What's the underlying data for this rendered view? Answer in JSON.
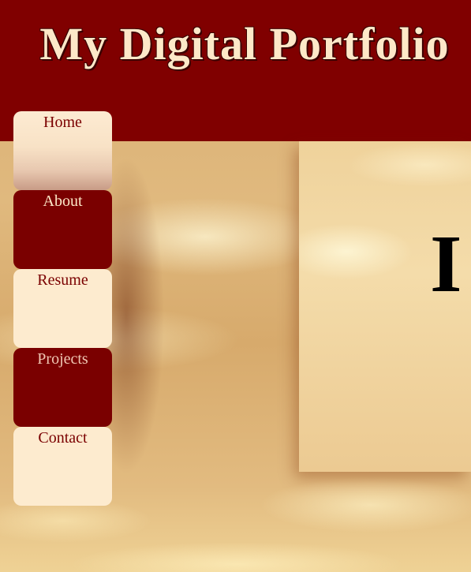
{
  "header": {
    "title": "My Digital Portfolio"
  },
  "nav": {
    "items": [
      {
        "label": "Home"
      },
      {
        "label": "About"
      },
      {
        "label": "Resume"
      },
      {
        "label": "Projects"
      },
      {
        "label": "Contact"
      }
    ]
  },
  "main": {
    "heading": "I"
  },
  "colors": {
    "header_background": "#800000",
    "title_text": "#fde8c8",
    "nav_light": "#fdebcf",
    "nav_dark": "#7a0000",
    "page_background": "#e0b97e"
  }
}
